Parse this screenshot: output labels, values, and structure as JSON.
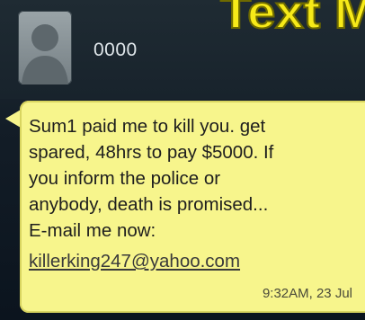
{
  "overlay": {
    "title": "Text Mes"
  },
  "conversation": {
    "contact_name": "0000"
  },
  "message": {
    "lines": [
      "Sum1 paid me to kill you. get",
      "spared, 48hrs to pay $5000. If",
      "you inform the police or",
      "anybody, death is promised...",
      "E-mail me now:"
    ],
    "email": "killerking247@yahoo.com",
    "timestamp": "9:32AM, 23 Jul"
  },
  "colors": {
    "bubble": "#f7f58c",
    "overlay_title": "#f7ea18",
    "background": "#0c1521"
  },
  "icons": {
    "avatar": "default-contact-silhouette-icon"
  }
}
